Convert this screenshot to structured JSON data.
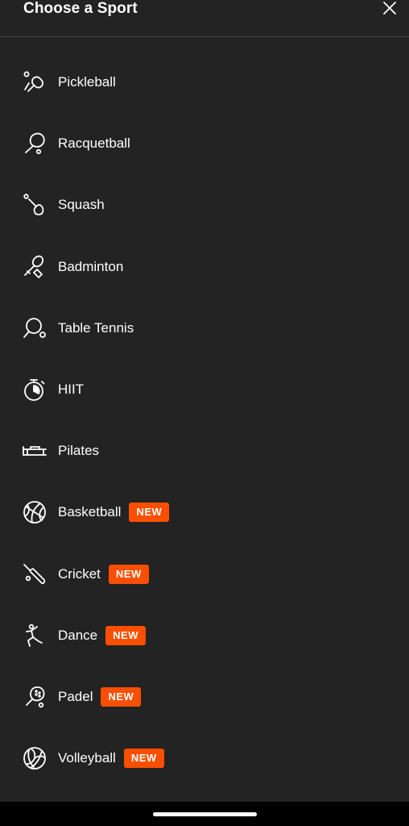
{
  "header": {
    "title": "Choose a Sport",
    "close_icon": "close-icon"
  },
  "sports": [
    {
      "label": "Pickleball",
      "icon": "pickleball-paddle-icon",
      "badge": ""
    },
    {
      "label": "Racquetball",
      "icon": "racquetball-racquet-icon",
      "badge": ""
    },
    {
      "label": "Squash",
      "icon": "squash-racquet-icon",
      "badge": ""
    },
    {
      "label": "Badminton",
      "icon": "badminton-racquet-icon",
      "badge": ""
    },
    {
      "label": "Table Tennis",
      "icon": "table-tennis-paddle-icon",
      "badge": ""
    },
    {
      "label": "HIIT",
      "icon": "stopwatch-icon",
      "badge": ""
    },
    {
      "label": "Pilates",
      "icon": "pilates-reformer-icon",
      "badge": ""
    },
    {
      "label": "Basketball",
      "icon": "basketball-icon",
      "badge": "NEW"
    },
    {
      "label": "Cricket",
      "icon": "cricket-bat-icon",
      "badge": "NEW"
    },
    {
      "label": "Dance",
      "icon": "dancer-icon",
      "badge": "NEW"
    },
    {
      "label": "Padel",
      "icon": "padel-racquet-icon",
      "badge": "NEW"
    },
    {
      "label": "Volleyball",
      "icon": "volleyball-icon",
      "badge": "NEW"
    }
  ],
  "colors": {
    "background": "#232323",
    "badge": "#fb4f00",
    "text": "#ffffff"
  }
}
